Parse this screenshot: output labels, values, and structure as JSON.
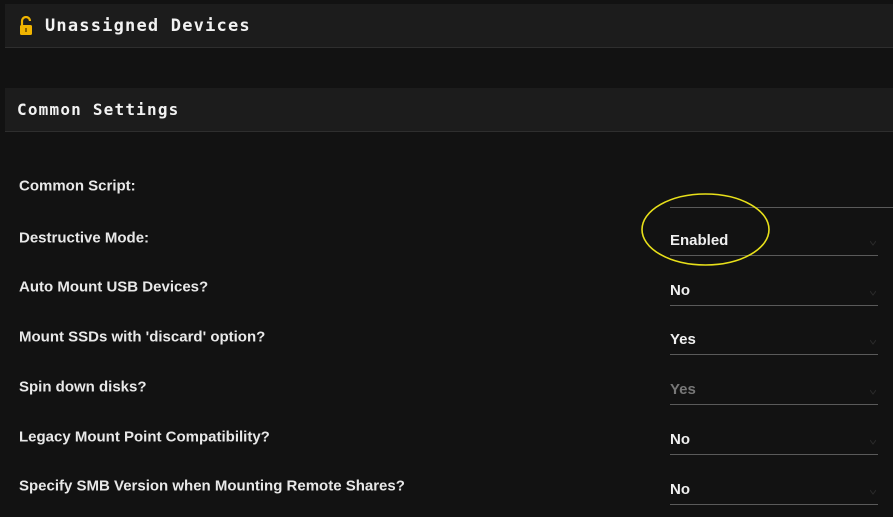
{
  "header": {
    "title": "Unassigned Devices",
    "icon": "lock-open-icon",
    "icon_color": "#f0b400"
  },
  "section": {
    "title": "Common Settings"
  },
  "settings": [
    {
      "label": "Common Script:",
      "value": "",
      "disabled": false
    },
    {
      "label": "Destructive Mode:",
      "value": "Enabled",
      "disabled": false
    },
    {
      "label": "Auto Mount USB Devices?",
      "value": "No",
      "disabled": false
    },
    {
      "label": "Mount SSDs with 'discard' option?",
      "value": "Yes",
      "disabled": false
    },
    {
      "label": "Spin down disks?",
      "value": "Yes",
      "disabled": true
    },
    {
      "label": "Legacy Mount Point Compatibility?",
      "value": "No",
      "disabled": false
    },
    {
      "label": "Specify SMB Version when Mounting Remote Shares?",
      "value": "No",
      "disabled": false
    }
  ],
  "colors": {
    "background": "#121212",
    "header_bg": "#1c1c1c",
    "annotation": "#e8e01a",
    "disabled_text": "#777777"
  }
}
